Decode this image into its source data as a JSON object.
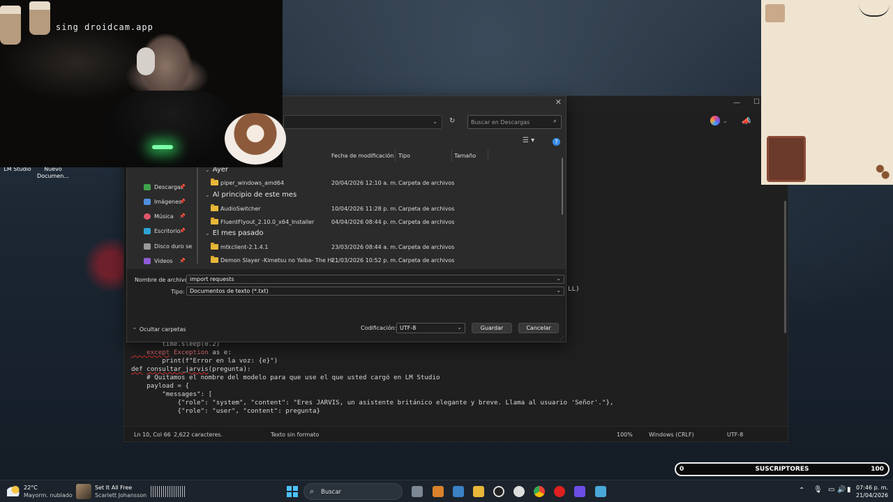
{
  "cam": {
    "watermark": "sing droidcam.app"
  },
  "desktop_icons": [
    {
      "label": "LM Studio"
    },
    {
      "label": "Nuevo Documen..."
    }
  ],
  "dialog": {
    "search_placeholder": "Buscar en Descargas",
    "columns": {
      "date": "Fecha de modificación",
      "type": "Tipo",
      "size": "Tamaño"
    },
    "sidebar": [
      {
        "label": "Descargas",
        "color": "#3fa34d"
      },
      {
        "label": "Imágenes",
        "color": "#4f8fde"
      },
      {
        "label": "Música",
        "color": "#e0566c"
      },
      {
        "label": "Escritorio",
        "color": "#2ea3d6"
      },
      {
        "label": "Disco duro se",
        "color": "#999999"
      },
      {
        "label": "Videos",
        "color": "#8e5bd6"
      }
    ],
    "groups": {
      "g1": "Ayer",
      "g2": "Al principio de este mes",
      "g3": "El mes pasado"
    },
    "files": [
      {
        "name": "piper_windows_amd64",
        "date": "20/04/2026 12:10 a. m.",
        "type": "Carpeta de archivos"
      },
      {
        "name": "AudioSwitcher",
        "date": "10/04/2026 11:28 p. m.",
        "type": "Carpeta de archivos"
      },
      {
        "name": "FluentFlyout_2.10.0_x64_Installer",
        "date": "04/04/2026 08:44 p. m.",
        "type": "Carpeta de archivos"
      },
      {
        "name": "mtkclient-2.1.4.1",
        "date": "23/03/2026 08:44 a. m.",
        "type": "Carpeta de archivos"
      },
      {
        "name": "Demon Slayer -Kimetsu no Yaiba- The Hi...",
        "date": "21/03/2026 10:52 p. m.",
        "type": "Carpeta de archivos"
      }
    ],
    "filename_label": "Nombre de archivo:",
    "filename_value": "import requests",
    "type_label": "Tipo:",
    "type_value": "Documentos de texto (*.txt)",
    "hide_folders": "Ocultar carpetas",
    "encoding_label": "Codificación:",
    "encoding_value": "UTF-8",
    "save": "Guardar",
    "cancel": "Cancelar"
  },
  "notepad": {
    "right_fragment": "LL)",
    "code": [
      "        time.sleep(0.2)",
      "    except Exception as e:",
      "        print(f\"Error en la voz: {e}\")",
      "",
      "def consultar_jarvis(pregunta):",
      "    # Quitamos el nombre del modelo para que use el que usted cargó en LM Studio",
      "    payload = {",
      "        \"messages\": [",
      "            {\"role\": \"system\", \"content\": \"Eres JARVIS, un asistente británico elegante y breve. Llama al usuario 'Señor'.\"},",
      "            {\"role\": \"user\", \"content\": pregunta}"
    ],
    "status": {
      "position": "Ln 10, Col 66",
      "chars": "2,622 caracteres.",
      "format": "Texto sin formato",
      "zoom": "100%",
      "eol": "Windows (CRLF)",
      "encoding": "UTF-8"
    }
  },
  "subscribers": {
    "left": "0",
    "label": "SUSCRIPTORES",
    "right": "100"
  },
  "taskbar": {
    "weather_temp": "22°C",
    "weather_desc": "Mayorm. nublado",
    "media_title": "Set It All Free",
    "media_artist": "Scarlett Johansson",
    "search": "Buscar",
    "time": "07:46 p. m.",
    "date": "21/04/2026"
  }
}
